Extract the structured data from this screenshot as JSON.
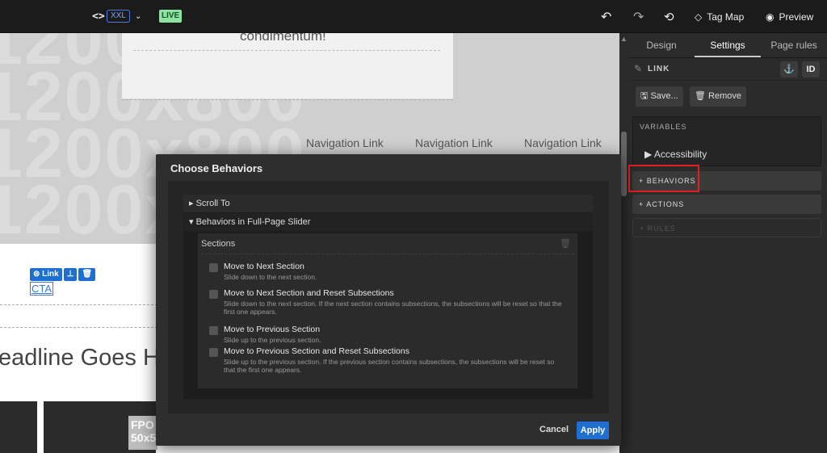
{
  "topbar": {
    "code_icon": "<>",
    "breakpoint": "XXL",
    "chevron": "⌄",
    "live": "LIVE",
    "undo_icon": "↶",
    "redo_icon": "↷",
    "history_icon": "⟲",
    "tag_icon": "◇",
    "tag_map": "Tag Map",
    "eye_icon": "◉",
    "preview": "Preview"
  },
  "canvas": {
    "placeholder_texts": [
      "1200x800",
      "1200x800",
      "1200x800",
      "1200x800"
    ],
    "card_text": "condimentum!",
    "nav_links": [
      "Navigation Link",
      "Navigation Link",
      "Navigation Link"
    ],
    "link_chip": {
      "label": "Link",
      "pin_icon": "⊥",
      "trash_icon": "🗑"
    },
    "cta": "CTA",
    "headline": "eadline Goes H",
    "fpo": "FPO\n50x5"
  },
  "panel": {
    "tabs": [
      "Design",
      "Settings",
      "Page rules"
    ],
    "active_tab": "Settings",
    "element_label": "LINK",
    "anchor_icon": "⚓",
    "id_label": "ID",
    "save": "Save...",
    "remove": "Remove",
    "variables": "VARIABLES",
    "accessibility": "Accessibility",
    "behaviors": "+ BEHAVIORS",
    "actions": "+ ACTIONS",
    "rules": "+ RULES",
    "highlight_color": "#e01f1f"
  },
  "modal": {
    "title": "Choose Behaviors",
    "group1": "Scroll To",
    "group2": "Behaviors in Full-Page Slider",
    "sections_label": "Sections",
    "options": [
      {
        "title": "Move to Next Section",
        "desc": "Slide down to the next section."
      },
      {
        "title": "Move to Next Section and Reset Subsections",
        "desc": "Slide down to the next section. If the next section contains subsections, the subsections will be reset so that the first one appears."
      },
      {
        "title": "Move to Previous Section",
        "desc": "Slide up to the previous section."
      },
      {
        "title": "Move to Previous Section and Reset Subsections",
        "desc": "Slide up to the previous section. If the previous section contains subsections, the subsections will be reset so that the first one appears."
      }
    ],
    "cancel": "Cancel",
    "apply": "Apply",
    "accent": "#1f6fd1"
  }
}
